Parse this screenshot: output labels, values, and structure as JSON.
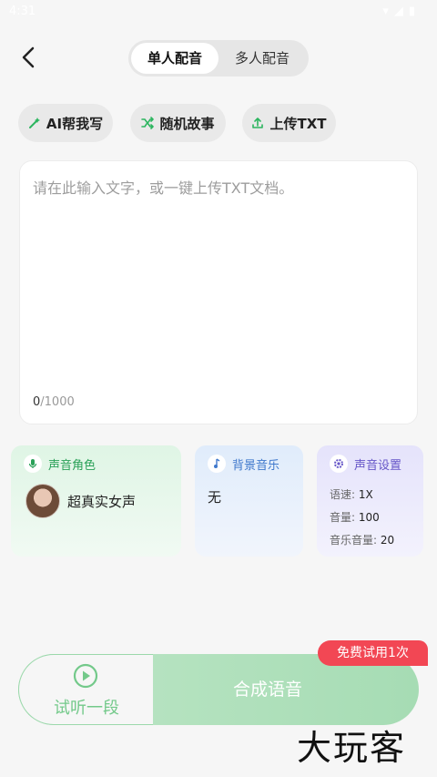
{
  "status_bar": {
    "time": "4:31"
  },
  "header": {
    "tabs": [
      {
        "label": "单人配音",
        "active": true
      },
      {
        "label": "多人配音",
        "active": false
      }
    ]
  },
  "actions": {
    "ai_write": "AI帮我写",
    "random_story": "随机故事",
    "upload_txt": "上传TXT"
  },
  "editor": {
    "placeholder": "请在此输入文字，或一键上传TXT文档。",
    "count": "0",
    "max": "/1000"
  },
  "cards": {
    "voice": {
      "title": "声音角色",
      "name": "超真实女声"
    },
    "bgm": {
      "title": "背景音乐",
      "value": "无"
    },
    "settings": {
      "title": "声音设置",
      "speed_label": "语速:",
      "speed_value": "1X",
      "volume_label": "音量:",
      "volume_value": "100",
      "music_label": "音乐音量:",
      "music_value": "20"
    }
  },
  "bottom": {
    "listen_label": "试听一段",
    "synth_label": "合成语音",
    "badge": "免费试用1次"
  },
  "watermark": "大玩客",
  "colors": {
    "accent_green": "#2cb55f",
    "badge_red": "#f24754",
    "synth_button": "#a6dcb4"
  }
}
